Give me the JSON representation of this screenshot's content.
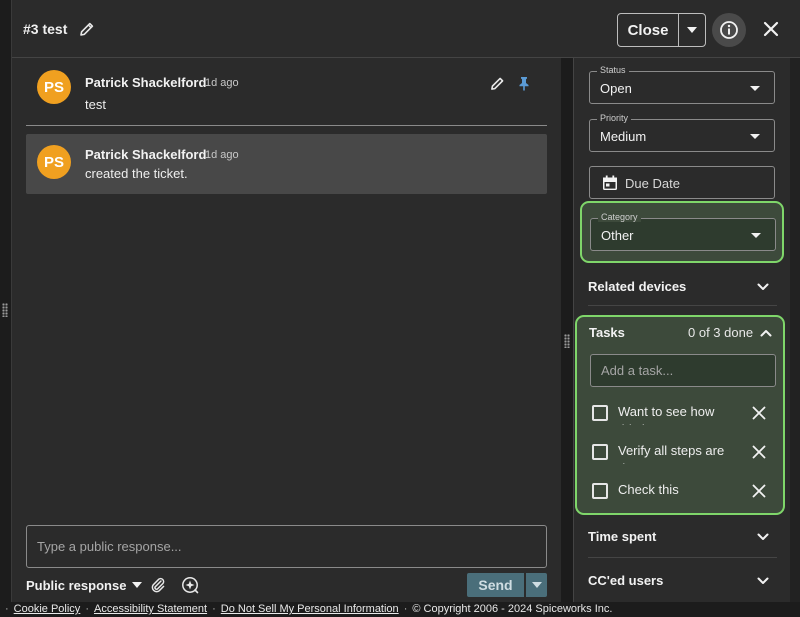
{
  "header": {
    "ticket_title": "#3 test",
    "close_label": "Close"
  },
  "conversation": {
    "messages": [
      {
        "initials": "PS",
        "author": "Patrick Shackelford",
        "time": "1d ago",
        "body": "test"
      },
      {
        "initials": "PS",
        "author": "Patrick Shackelford",
        "time": "1d ago",
        "body": "created the ticket."
      }
    ]
  },
  "composer": {
    "placeholder": "Type a public response...",
    "response_type": "Public response",
    "send_label": "Send"
  },
  "sidebar": {
    "status": {
      "label": "Status",
      "value": "Open"
    },
    "priority": {
      "label": "Priority",
      "value": "Medium"
    },
    "due_date": {
      "placeholder": "Due Date"
    },
    "category": {
      "label": "Category",
      "value": "Other"
    },
    "related_devices": {
      "title": "Related devices"
    },
    "tasks": {
      "title": "Tasks",
      "count": "0 of 3 done",
      "add_placeholder": "Add a task...",
      "items": [
        {
          "text": "Want to see how this is"
        },
        {
          "text": "Verify all steps are done"
        },
        {
          "text": "Check this"
        }
      ]
    },
    "time_spent": {
      "title": "Time spent"
    },
    "cced_users": {
      "title": "CC'ed users"
    }
  },
  "footer": {
    "links": [
      "Cookie Policy",
      "Accessibility Statement",
      "Do Not Sell My Personal Information"
    ],
    "copyright": "© Copyright 2006 - 2024 Spiceworks Inc."
  },
  "colors": {
    "avatar": "#f0a020",
    "highlight_border": "#7fd66a",
    "send_button": "#4a6e7a",
    "panel_bg": "#2b2b2b"
  },
  "icons": {
    "edit": "pencil-icon",
    "pin": "pin-icon",
    "info": "info-icon",
    "close": "close-icon",
    "calendar": "calendar-icon",
    "attach": "paperclip-icon",
    "ai": "ai-sparkle-icon"
  }
}
